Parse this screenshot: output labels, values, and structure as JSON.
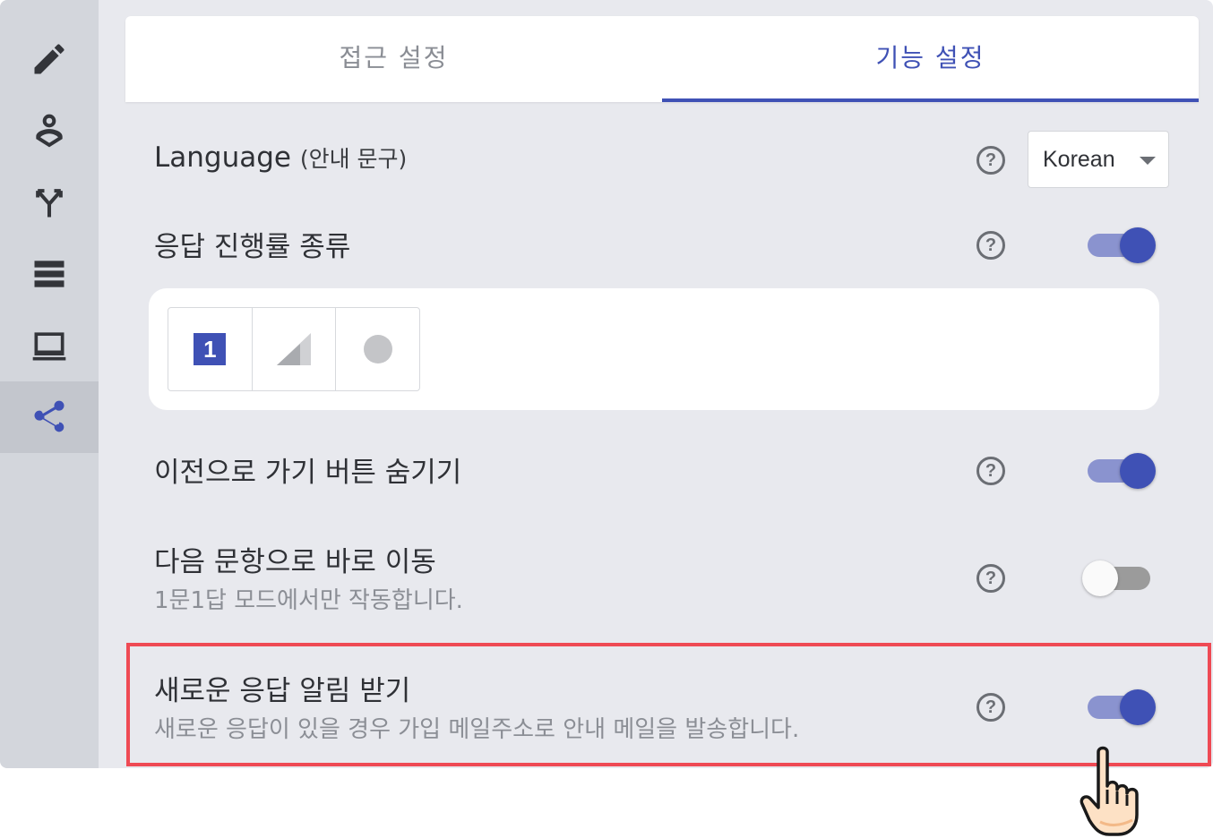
{
  "sidebar": {
    "items": [
      {
        "icon": "pencil-icon"
      },
      {
        "icon": "person-badge-icon"
      },
      {
        "icon": "branch-icon"
      },
      {
        "icon": "layout-list-icon"
      },
      {
        "icon": "monitor-icon"
      },
      {
        "icon": "share-icon",
        "active": true
      }
    ]
  },
  "tabs": [
    {
      "label": "접근 설정",
      "active": false
    },
    {
      "label": "기능 설정",
      "active": true
    }
  ],
  "settings": {
    "language": {
      "title": "Language",
      "title_suffix": "(안내 문구)",
      "selected": "Korean"
    },
    "progress_type": {
      "title": "응답 진행률 종류",
      "enabled": true,
      "options": [
        {
          "icon": "number-icon",
          "label": "1",
          "selected": true
        },
        {
          "icon": "triangle-icon",
          "selected": false
        },
        {
          "icon": "circle-icon",
          "selected": false
        }
      ]
    },
    "hide_prev_button": {
      "title": "이전으로 가기 버튼 숨기기",
      "enabled": true
    },
    "auto_next": {
      "title": "다음 문항으로 바로 이동",
      "subtitle": "1문1답 모드에서만 작동합니다.",
      "enabled": false
    },
    "notify_new_response": {
      "title": "새로운 응답 알림 받기",
      "subtitle": "새로운 응답이 있을 경우 가입 메일주소로 안내 메일을 발송합니다.",
      "enabled": true
    }
  },
  "help_glyph": "?",
  "colors": {
    "accent": "#3f51b5",
    "highlight": "#ef4a54"
  }
}
